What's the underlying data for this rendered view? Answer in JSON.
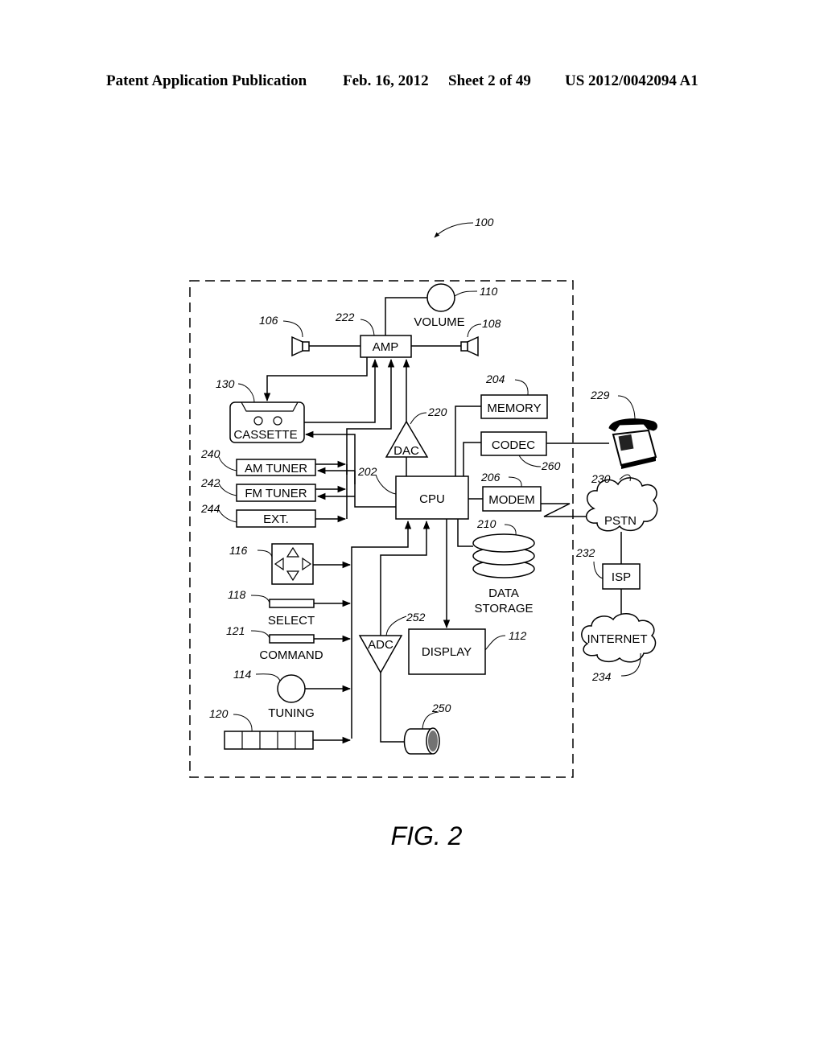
{
  "header": {
    "left": "Patent Application Publication",
    "date": "Feb. 16, 2012",
    "sheet": "Sheet 2 of 49",
    "number": "US 2012/0042094 A1"
  },
  "figure": {
    "caption": "FIG. 2",
    "system_ref": "100",
    "components": {
      "amp": {
        "label": "AMP",
        "ref": "222"
      },
      "volume": {
        "label": "VOLUME",
        "ref": "110"
      },
      "speaker_left": {
        "ref": "106"
      },
      "speaker_right": {
        "ref": "108"
      },
      "cassette": {
        "label": "CASSETTE",
        "ref": "130"
      },
      "dac": {
        "label": "DAC",
        "ref": "220"
      },
      "memory": {
        "label": "MEMORY",
        "ref": "204"
      },
      "codec": {
        "label": "CODEC",
        "ref": "260"
      },
      "telephone": {
        "ref": "229"
      },
      "am_tuner": {
        "label": "AM TUNER",
        "ref": "240"
      },
      "fm_tuner": {
        "label": "FM TUNER",
        "ref": "242"
      },
      "ext": {
        "label": "EXT.",
        "ref": "244"
      },
      "cpu": {
        "label": "CPU",
        "ref": "202"
      },
      "modem": {
        "label": "MODEM",
        "ref": "206"
      },
      "pstn": {
        "label": "PSTN",
        "ref": "230"
      },
      "data_storage": {
        "label_line1": "DATA",
        "label_line2": "STORAGE",
        "ref": "210"
      },
      "isp": {
        "label": "ISP",
        "ref": "232"
      },
      "internet": {
        "label": "INTERNET",
        "ref": "234"
      },
      "dpad": {
        "ref": "116"
      },
      "select": {
        "label": "SELECT",
        "ref": "118"
      },
      "command": {
        "label": "COMMAND",
        "ref": "121"
      },
      "tuning": {
        "label": "TUNING",
        "ref": "114"
      },
      "presets": {
        "ref": "120"
      },
      "adc": {
        "label": "ADC",
        "ref": "252"
      },
      "display": {
        "label": "DISPLAY",
        "ref": "112"
      },
      "microphone": {
        "ref": "250"
      }
    }
  }
}
